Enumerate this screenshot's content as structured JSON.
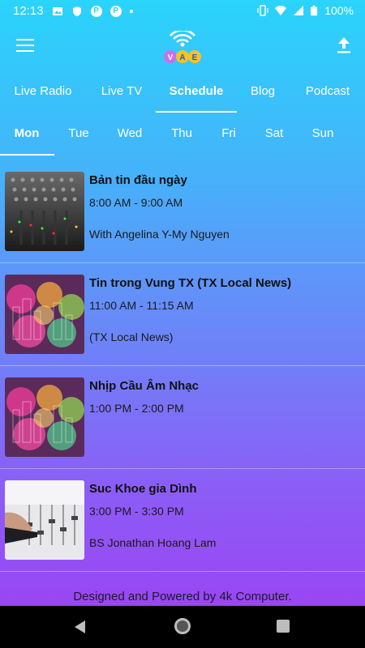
{
  "status_bar": {
    "time": "12:13",
    "battery": "100%",
    "icons": [
      "image-icon",
      "shield-icon",
      "p-icon",
      "p-icon",
      "dot-icon",
      "vibrate-icon",
      "wifi-icon",
      "signal-icon",
      "battery-icon"
    ]
  },
  "app_bar": {
    "menu_icon": "hamburger-menu-icon",
    "logo_letters": [
      "V",
      "A",
      "E"
    ],
    "share_icon": "upload-icon"
  },
  "tabs": [
    {
      "label": "Live Radio"
    },
    {
      "label": "Live TV"
    },
    {
      "label": "Schedule",
      "active": true
    },
    {
      "label": "Blog"
    },
    {
      "label": "Podcast"
    }
  ],
  "days": [
    {
      "label": "Mon",
      "active": true
    },
    {
      "label": "Tue"
    },
    {
      "label": "Wed"
    },
    {
      "label": "Thu"
    },
    {
      "label": "Fri"
    },
    {
      "label": "Sat"
    },
    {
      "label": "Sun"
    }
  ],
  "schedule": [
    {
      "title": "Bản tin đầu ngày",
      "time": "8:00 AM - 9:00 AM",
      "host": "With Angelina Y-My Nguyen",
      "thumb": "mixer-console"
    },
    {
      "title": "Tin trong Vung TX (TX Local News)",
      "time": "11:00 AM - 11:15 AM",
      "host": "(TX Local News)",
      "thumb": "city-bokeh"
    },
    {
      "title": "Nhịp Cầu Âm Nhạc",
      "time": "1:00 PM - 2:00 PM",
      "host": "",
      "thumb": "city-bokeh"
    },
    {
      "title": "Suc Khoe gia Dình",
      "time": "3:00 PM - 3:30 PM",
      "host": "BS Jonathan Hoang Lam",
      "thumb": "mixer-hand"
    }
  ],
  "footer": "Designed and Powered by 4k Computer.",
  "colors": {
    "gradient_top": "#2ad4fb",
    "gradient_bottom": "#9a46f3"
  }
}
